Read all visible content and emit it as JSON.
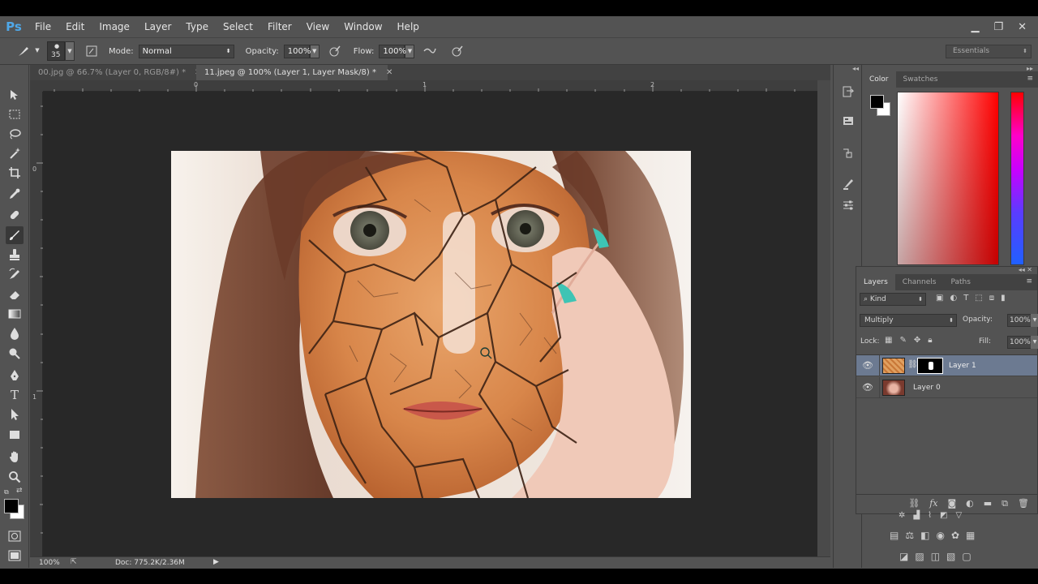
{
  "app": {
    "logo": "Ps"
  },
  "menu": [
    "File",
    "Edit",
    "Image",
    "Layer",
    "Type",
    "Select",
    "Filter",
    "View",
    "Window",
    "Help"
  ],
  "window_controls": {
    "minimize": "▁",
    "restore": "❐",
    "close": "✕"
  },
  "options_bar": {
    "brush_size": "35",
    "mode_label": "Mode:",
    "mode_value": "Normal",
    "opacity_label": "Opacity:",
    "opacity_value": "100%",
    "flow_label": "Flow:",
    "flow_value": "100%",
    "workspace": "Essentials"
  },
  "tabs": [
    {
      "label": "00.jpg @ 66.7% (Layer 0, RGB/8#) *",
      "active": false
    },
    {
      "label": "11.jpeg @ 100% (Layer 1, Layer Mask/8) *",
      "active": true
    }
  ],
  "rulers": {
    "h": [
      "0",
      "1",
      "2"
    ],
    "v": [
      "0",
      "1"
    ]
  },
  "status": {
    "zoom": "100%",
    "doc": "Doc: 775.2K/2.36M"
  },
  "color_panel": {
    "tabs": [
      "Color",
      "Swatches"
    ],
    "foreground": "#000000",
    "background": "#ffffff",
    "hue_base": "#ff0000"
  },
  "layers_panel": {
    "tabs": [
      "Layers",
      "Channels",
      "Paths"
    ],
    "filter": "Kind",
    "blend_mode": "Multiply",
    "opacity_label": "Opacity:",
    "opacity_value": "100%",
    "lock_label": "Lock:",
    "fill_label": "Fill:",
    "fill_value": "100%",
    "layers": [
      {
        "name": "Layer 1",
        "selected": true
      },
      {
        "name": "Layer 0",
        "selected": false
      }
    ]
  },
  "colors": {
    "accent": "#4fa8e8",
    "selection": "#6c7a91",
    "panel": "#535353"
  }
}
